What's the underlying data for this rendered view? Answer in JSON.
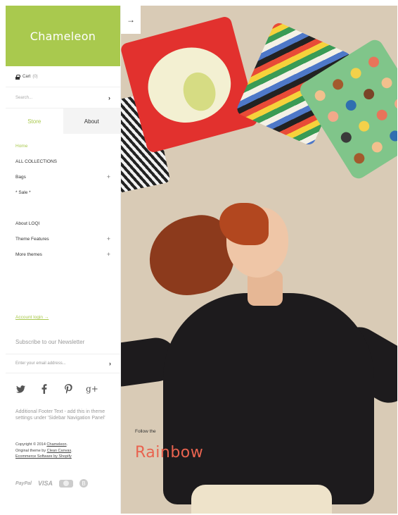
{
  "brand": {
    "name": "Chameleon",
    "color": "#a9c94e"
  },
  "cart": {
    "label": "Cart",
    "count": "(0)"
  },
  "search": {
    "placeholder": "Search..."
  },
  "tabs": [
    {
      "label": "Store",
      "active": true
    },
    {
      "label": "About",
      "active": false
    }
  ],
  "nav": {
    "home": "Home",
    "all_collections": "ALL COLLECTIONS",
    "bags": "Bags",
    "sale": "* Sale *",
    "about_loqi": "About LOQI",
    "theme_features": "Theme Features",
    "more_themes": "More themes"
  },
  "account": {
    "label": "Account login →"
  },
  "newsletter": {
    "title": "Subscribe to our Newsletter",
    "placeholder": "Enter your email address..."
  },
  "social": {
    "icons": [
      "twitter-icon",
      "facebook-icon",
      "pinterest-icon",
      "google-plus-icon"
    ],
    "labels": [
      "t",
      "f",
      "P",
      "g+"
    ]
  },
  "footer": {
    "text": "Additional Footer Text - add this in theme settings under 'Sidebar Navigation Panel'",
    "copyright_prefix": "Copyright © 2014",
    "copyright_link": "Chameleon",
    "original_prefix": "Original theme by",
    "original_link": "Clean Canvas",
    "ecommerce_link": "Ecommerce Software by Shopify"
  },
  "payments": {
    "paypal": "PayPal",
    "visa": "VISA",
    "bitcoin": "B"
  },
  "hero": {
    "arrow": "→",
    "follow": "Follow the",
    "title": "Rainbow",
    "title_color": "#e9634f"
  }
}
